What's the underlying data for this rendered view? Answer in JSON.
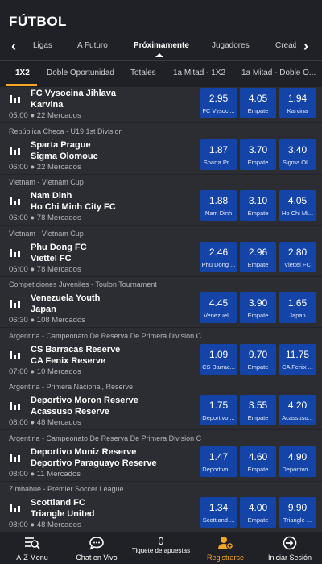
{
  "header": {
    "title": "FÚTBOL"
  },
  "nav": {
    "left_arrow": "‹",
    "right_arrow": "›",
    "items": [
      "Ligas",
      "A Futuro",
      "Próximamente",
      "Jugadores",
      "Creador"
    ]
  },
  "tabs": [
    "1X2",
    "Doble Oportunidad",
    "Totales",
    "1a Mitad - 1X2",
    "1a Mitad - Doble O..."
  ],
  "matches": [
    {
      "league": "",
      "home": "FC Vysocina Jihlava",
      "away": "Karvina",
      "meta": "05:00 ● 22 Mercados",
      "odds": [
        {
          "v": "2.95",
          "l": "FC Vysoci..."
        },
        {
          "v": "4.05",
          "l": "Empate"
        },
        {
          "v": "1.94",
          "l": "Karvina"
        }
      ]
    },
    {
      "league": "República Checa - U19 1st Division",
      "home": "Sparta Prague",
      "away": "Sigma Olomouc",
      "meta": "06:00 ● 22 Mercados",
      "odds": [
        {
          "v": "1.87",
          "l": "Sparta Pr..."
        },
        {
          "v": "3.70",
          "l": "Empate"
        },
        {
          "v": "3.40",
          "l": "Sigma Ol..."
        }
      ]
    },
    {
      "league": "Vietnam - Vietnam Cup",
      "home": "Nam Dinh",
      "away": "Ho Chi Minh City FC",
      "meta": "06:00 ● 78 Mercados",
      "odds": [
        {
          "v": "1.88",
          "l": "Nam Dinh"
        },
        {
          "v": "3.10",
          "l": "Empate"
        },
        {
          "v": "4.05",
          "l": "Ho Chi Mi..."
        }
      ]
    },
    {
      "league": "Vietnam - Vietnam Cup",
      "home": "Phu Dong FC",
      "away": "Viettel FC",
      "meta": "06:00 ● 78 Mercados",
      "odds": [
        {
          "v": "2.46",
          "l": "Phu Dong ..."
        },
        {
          "v": "2.96",
          "l": "Empate"
        },
        {
          "v": "2.80",
          "l": "Viettel FC"
        }
      ]
    },
    {
      "league": "Competiciones Juveniles - Toulon Tournament",
      "home": "Venezuela Youth",
      "away": "Japan",
      "meta": "06:30 ● 108 Mercados",
      "odds": [
        {
          "v": "4.45",
          "l": "Venezuel..."
        },
        {
          "v": "3.90",
          "l": "Empate"
        },
        {
          "v": "1.65",
          "l": "Japan"
        }
      ]
    },
    {
      "league": "Argentina - Campeonato De Reserva De Primera Division C",
      "home": "CS Barracas Reserve",
      "away": "CA Fenix Reserve",
      "meta": "07:00 ● 10 Mercados",
      "odds": [
        {
          "v": "1.09",
          "l": "CS Barrac..."
        },
        {
          "v": "9.70",
          "l": "Empate"
        },
        {
          "v": "11.75",
          "l": "CA Fenix ..."
        }
      ]
    },
    {
      "league": "Argentina - Primera Nacional, Reserve",
      "home": "Deportivo Moron Reserve",
      "away": "Acassuso Reserve",
      "meta": "08:00 ● 48 Mercados",
      "odds": [
        {
          "v": "1.75",
          "l": "Deportivo ..."
        },
        {
          "v": "3.55",
          "l": "Empate"
        },
        {
          "v": "4.20",
          "l": "Acassuso..."
        }
      ]
    },
    {
      "league": "Argentina - Campeonato De Reserva De Primera Division C",
      "home": "Deportivo Muniz Reserve",
      "away": "Deportivo Paraguayo Reserve",
      "meta": "08:00 ● 11 Mercados",
      "odds": [
        {
          "v": "1.47",
          "l": "Deportivo ..."
        },
        {
          "v": "4.60",
          "l": "Empate"
        },
        {
          "v": "4.90",
          "l": "Deportivo..."
        }
      ]
    },
    {
      "league": "Zimbabue - Premier Soccer League",
      "home": "Scottland FC",
      "away": "Triangle United",
      "meta": "08:00 ● 48 Mercados",
      "odds": [
        {
          "v": "1.34",
          "l": "Scottland ..."
        },
        {
          "v": "4.00",
          "l": "Empate"
        },
        {
          "v": "9.90",
          "l": "Triangle ..."
        }
      ]
    }
  ],
  "bottom_nav": {
    "az_menu": "A-Z Menu",
    "chat": "Chat en Vivo",
    "ticket_count": "0",
    "ticket_label": "Tiquete de apuestas",
    "register": "Registrarse",
    "login": "Iniciar Sesión"
  },
  "colors": {
    "accent": "#f5a623",
    "odds_bg": "#1444a8",
    "background": "#2b2d33",
    "header_bg": "#1f2126"
  }
}
